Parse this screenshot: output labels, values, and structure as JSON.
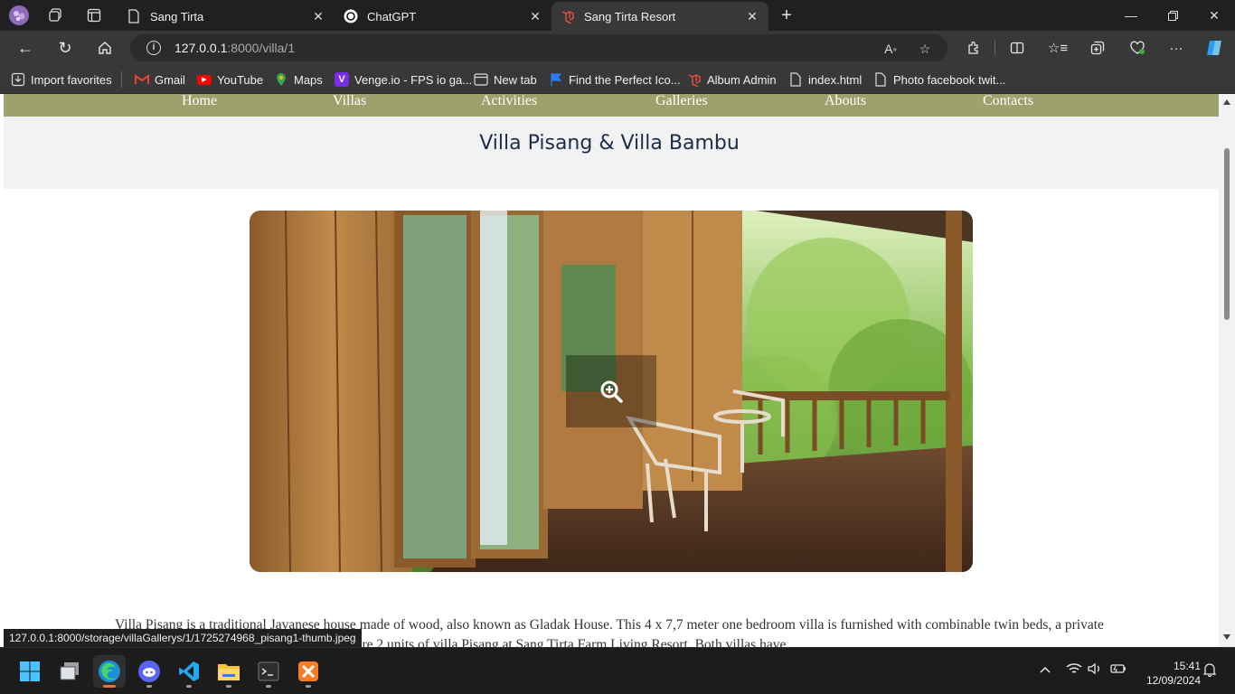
{
  "browser": {
    "tabs": [
      {
        "label": "Sang Tirta",
        "icon": "page-icon",
        "active": false
      },
      {
        "label": "ChatGPT",
        "icon": "chatgpt-icon",
        "active": false
      },
      {
        "label": "Sang Tirta Resort",
        "icon": "laravel-icon",
        "active": true
      }
    ],
    "address": {
      "host": "127.0.0.1",
      "path": ":8000/villa/1"
    },
    "bookmarks": [
      {
        "label": "Import favorites",
        "icon": "import-icon"
      },
      {
        "label": "Gmail",
        "icon": "gmail-icon"
      },
      {
        "label": "YouTube",
        "icon": "youtube-icon"
      },
      {
        "label": "Maps",
        "icon": "maps-icon"
      },
      {
        "label": "Venge.io - FPS io ga...",
        "icon": "venge-icon"
      },
      {
        "label": "New tab",
        "icon": "newtab-icon"
      },
      {
        "label": "Find the Perfect Ico...",
        "icon": "flag-icon"
      },
      {
        "label": "Album Admin",
        "icon": "laravel-icon"
      },
      {
        "label": "index.html",
        "icon": "file-icon"
      },
      {
        "label": "Photo facebook twit...",
        "icon": "file-icon"
      }
    ]
  },
  "site": {
    "nav": [
      "Home",
      "Villas",
      "Activities",
      "Galleries",
      "Abouts",
      "Contacts"
    ],
    "title": "Villa Pisang & Villa Bambu",
    "description": "Villa Pisang is a traditional Javanese house made of wood, also known as Gladak House. This 4 x 7,7 meter one bedroom villa is furnished with combinable twin beds, a private bathroom with hot and cold shower. There are 2 units of villa Pisang at Sang Tirta Farm Living Resort. Both villas have"
  },
  "status_url": "127.0.0.1:8000/storage/villaGallerys/1/1725274968_pisang1-thumb.jpeg",
  "clock": {
    "time": "15:41",
    "date": "12/09/2024"
  },
  "colors": {
    "nav_bg": "#9da26d",
    "title": "#1c2c4c",
    "band": "#f2f2f2"
  }
}
